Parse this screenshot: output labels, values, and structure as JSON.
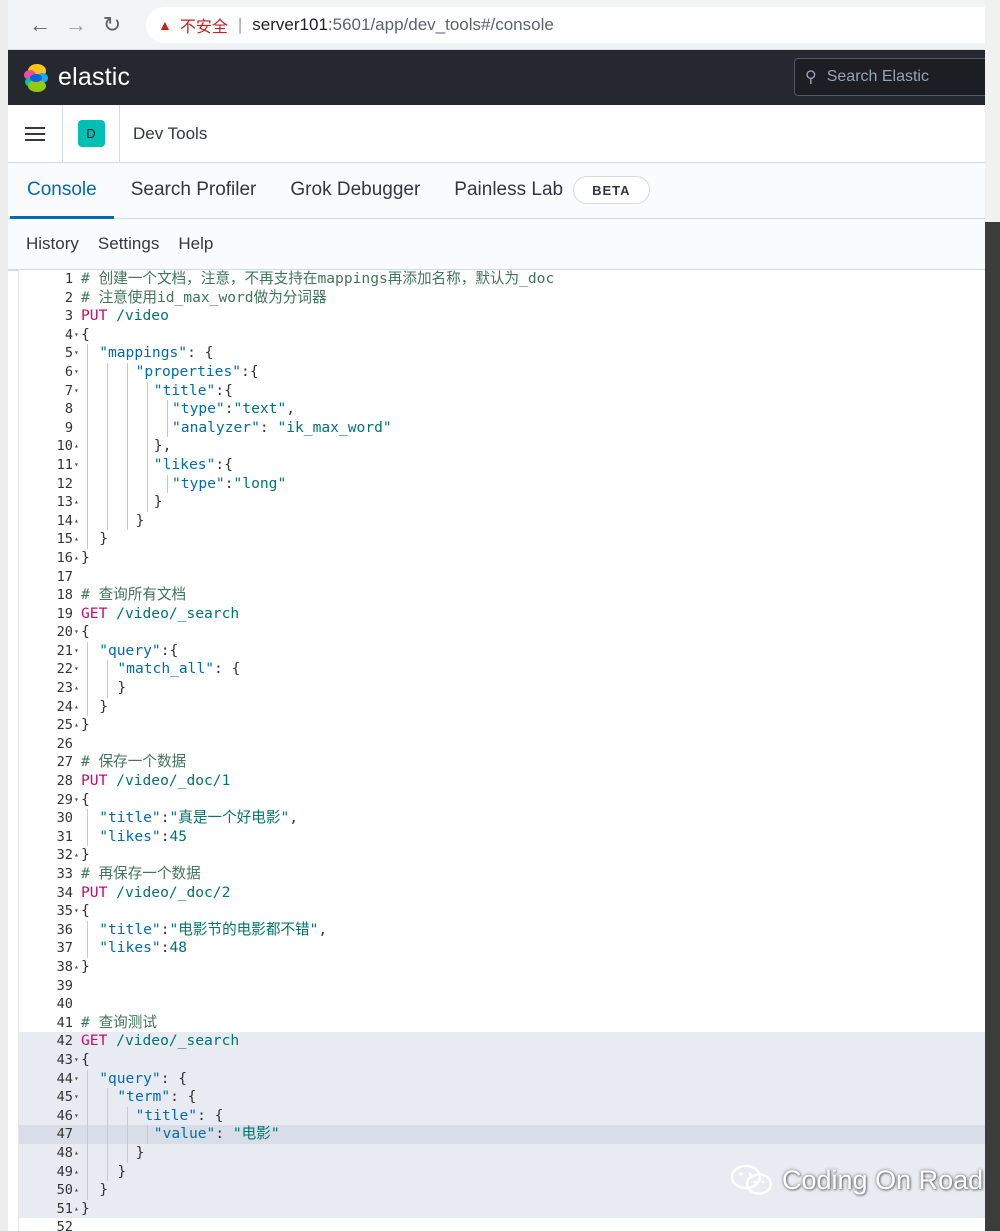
{
  "browser": {
    "insecure_label": "不安全",
    "separator": "|",
    "url_host": "server101",
    "url_rest": ":5601/app/dev_tools#/console"
  },
  "header": {
    "brand": "elastic",
    "search_placeholder": "Search Elastic"
  },
  "breadcrumb": {
    "space_initial": "D",
    "app_title": "Dev Tools"
  },
  "tabs": [
    {
      "label": "Console",
      "active": true
    },
    {
      "label": "Search Profiler",
      "active": false
    },
    {
      "label": "Grok Debugger",
      "active": false
    },
    {
      "label": "Painless Lab",
      "active": false
    }
  ],
  "beta_badge": "BETA",
  "console_menu": [
    "History",
    "Settings",
    "Help"
  ],
  "editor": {
    "lines": [
      {
        "n": "1",
        "fold": "",
        "indent": 0,
        "tokens": [
          [
            "c-comment",
            "# 创建一个文档，注意，不再支持在mappings再添加名称，默认为_doc"
          ]
        ]
      },
      {
        "n": "2",
        "fold": "",
        "indent": 0,
        "tokens": [
          [
            "c-comment",
            "# 注意使用id_max_word做为分词器"
          ]
        ]
      },
      {
        "n": "3",
        "fold": "",
        "indent": 0,
        "tokens": [
          [
            "c-method",
            "PUT"
          ],
          [
            "",
            " "
          ],
          [
            "c-url",
            "/video"
          ]
        ]
      },
      {
        "n": "4",
        "fold": "down",
        "indent": 0,
        "tokens": [
          [
            "c-brace",
            "{"
          ]
        ]
      },
      {
        "n": "5",
        "fold": "down",
        "indent": 1,
        "tokens": [
          [
            "c-key",
            "\"mappings\""
          ],
          [
            "c-brace",
            ": {"
          ]
        ]
      },
      {
        "n": "6",
        "fold": "down",
        "indent": 3,
        "tokens": [
          [
            "c-key",
            "\"properties\""
          ],
          [
            "c-brace",
            ":{"
          ]
        ]
      },
      {
        "n": "7",
        "fold": "down",
        "indent": 4,
        "tokens": [
          [
            "c-key",
            "\"title\""
          ],
          [
            "c-brace",
            ":{"
          ]
        ]
      },
      {
        "n": "8",
        "fold": "",
        "indent": 5,
        "tokens": [
          [
            "c-key",
            "\"type\""
          ],
          [
            "c-brace",
            ":"
          ],
          [
            "c-str",
            "\"text\""
          ],
          [
            "c-brace",
            ","
          ]
        ]
      },
      {
        "n": "9",
        "fold": "",
        "indent": 5,
        "tokens": [
          [
            "c-key",
            "\"analyzer\""
          ],
          [
            "c-brace",
            ": "
          ],
          [
            "c-str",
            "\"ik_max_word\""
          ]
        ]
      },
      {
        "n": "10",
        "fold": "up",
        "indent": 4,
        "tokens": [
          [
            "c-brace",
            "},"
          ]
        ]
      },
      {
        "n": "11",
        "fold": "down",
        "indent": 4,
        "tokens": [
          [
            "c-key",
            "\"likes\""
          ],
          [
            "c-brace",
            ":{"
          ]
        ]
      },
      {
        "n": "12",
        "fold": "",
        "indent": 5,
        "tokens": [
          [
            "c-key",
            "\"type\""
          ],
          [
            "c-brace",
            ":"
          ],
          [
            "c-str",
            "\"long\""
          ]
        ]
      },
      {
        "n": "13",
        "fold": "up",
        "indent": 4,
        "tokens": [
          [
            "c-brace",
            "}"
          ]
        ]
      },
      {
        "n": "14",
        "fold": "up",
        "indent": 3,
        "tokens": [
          [
            "c-brace",
            "}"
          ]
        ]
      },
      {
        "n": "15",
        "fold": "up",
        "indent": 1,
        "tokens": [
          [
            "c-brace",
            "}"
          ]
        ]
      },
      {
        "n": "16",
        "fold": "up",
        "indent": 0,
        "tokens": [
          [
            "c-brace",
            "}"
          ]
        ]
      },
      {
        "n": "17",
        "fold": "",
        "indent": 0,
        "tokens": []
      },
      {
        "n": "18",
        "fold": "",
        "indent": 0,
        "tokens": [
          [
            "c-comment",
            "# 查询所有文档"
          ]
        ]
      },
      {
        "n": "19",
        "fold": "",
        "indent": 0,
        "tokens": [
          [
            "c-method",
            "GET"
          ],
          [
            "",
            " "
          ],
          [
            "c-url",
            "/video/_search"
          ]
        ]
      },
      {
        "n": "20",
        "fold": "down",
        "indent": 0,
        "tokens": [
          [
            "c-brace",
            "{"
          ]
        ]
      },
      {
        "n": "21",
        "fold": "down",
        "indent": 1,
        "tokens": [
          [
            "c-key",
            "\"query\""
          ],
          [
            "c-brace",
            ":{"
          ]
        ]
      },
      {
        "n": "22",
        "fold": "down",
        "indent": 2,
        "tokens": [
          [
            "c-key",
            "\"match_all\""
          ],
          [
            "c-brace",
            ": {"
          ]
        ]
      },
      {
        "n": "23",
        "fold": "up",
        "indent": 2,
        "tokens": [
          [
            "c-brace",
            "}"
          ]
        ]
      },
      {
        "n": "24",
        "fold": "up",
        "indent": 1,
        "tokens": [
          [
            "c-brace",
            "}"
          ]
        ]
      },
      {
        "n": "25",
        "fold": "up",
        "indent": 0,
        "tokens": [
          [
            "c-brace",
            "}"
          ]
        ]
      },
      {
        "n": "26",
        "fold": "",
        "indent": 0,
        "tokens": []
      },
      {
        "n": "27",
        "fold": "",
        "indent": 0,
        "tokens": [
          [
            "c-comment",
            "# 保存一个数据"
          ]
        ]
      },
      {
        "n": "28",
        "fold": "",
        "indent": 0,
        "tokens": [
          [
            "c-method",
            "PUT"
          ],
          [
            "",
            " "
          ],
          [
            "c-url",
            "/video/_doc/1"
          ]
        ]
      },
      {
        "n": "29",
        "fold": "down",
        "indent": 0,
        "tokens": [
          [
            "c-brace",
            "{"
          ]
        ]
      },
      {
        "n": "30",
        "fold": "",
        "indent": 1,
        "tokens": [
          [
            "c-key",
            "\"title\""
          ],
          [
            "c-brace",
            ":"
          ],
          [
            "c-str",
            "\"真是一个好电影\""
          ],
          [
            "c-brace",
            ","
          ]
        ]
      },
      {
        "n": "31",
        "fold": "",
        "indent": 1,
        "tokens": [
          [
            "c-key",
            "\"likes\""
          ],
          [
            "c-brace",
            ":"
          ],
          [
            "c-num",
            "45"
          ]
        ]
      },
      {
        "n": "32",
        "fold": "up",
        "indent": 0,
        "tokens": [
          [
            "c-brace",
            "}"
          ]
        ]
      },
      {
        "n": "33",
        "fold": "",
        "indent": 0,
        "tokens": [
          [
            "c-comment",
            "# 再保存一个数据"
          ]
        ]
      },
      {
        "n": "34",
        "fold": "",
        "indent": 0,
        "tokens": [
          [
            "c-method",
            "PUT"
          ],
          [
            "",
            " "
          ],
          [
            "c-url",
            "/video/_doc/2"
          ]
        ]
      },
      {
        "n": "35",
        "fold": "down",
        "indent": 0,
        "tokens": [
          [
            "c-brace",
            "{"
          ]
        ]
      },
      {
        "n": "36",
        "fold": "",
        "indent": 1,
        "tokens": [
          [
            "c-key",
            "\"title\""
          ],
          [
            "c-brace",
            ":"
          ],
          [
            "c-str",
            "\"电影节的电影都不错\""
          ],
          [
            "c-brace",
            ","
          ]
        ]
      },
      {
        "n": "37",
        "fold": "",
        "indent": 1,
        "tokens": [
          [
            "c-key",
            "\"likes\""
          ],
          [
            "c-brace",
            ":"
          ],
          [
            "c-num",
            "48"
          ]
        ]
      },
      {
        "n": "38",
        "fold": "up",
        "indent": 0,
        "tokens": [
          [
            "c-brace",
            "}"
          ]
        ]
      },
      {
        "n": "39",
        "fold": "",
        "indent": 0,
        "tokens": []
      },
      {
        "n": "40",
        "fold": "",
        "indent": 0,
        "tokens": []
      },
      {
        "n": "41",
        "fold": "",
        "indent": 0,
        "tokens": [
          [
            "c-comment",
            "# 查询测试"
          ]
        ]
      },
      {
        "n": "42",
        "fold": "",
        "indent": 0,
        "req": true,
        "tokens": [
          [
            "c-method",
            "GET"
          ],
          [
            "",
            " "
          ],
          [
            "c-url",
            "/video/_search"
          ]
        ]
      },
      {
        "n": "43",
        "fold": "down",
        "indent": 0,
        "req": true,
        "tokens": [
          [
            "c-brace",
            "{"
          ]
        ]
      },
      {
        "n": "44",
        "fold": "down",
        "indent": 1,
        "req": true,
        "tokens": [
          [
            "c-key",
            "\"query\""
          ],
          [
            "c-brace",
            ": {"
          ]
        ]
      },
      {
        "n": "45",
        "fold": "down",
        "indent": 2,
        "req": true,
        "tokens": [
          [
            "c-key",
            "\"term\""
          ],
          [
            "c-brace",
            ": {"
          ]
        ]
      },
      {
        "n": "46",
        "fold": "down",
        "indent": 3,
        "req": true,
        "tokens": [
          [
            "c-key",
            "\"title\""
          ],
          [
            "c-brace",
            ": {"
          ]
        ]
      },
      {
        "n": "47",
        "fold": "",
        "indent": 4,
        "req": true,
        "active": true,
        "tokens": [
          [
            "c-key",
            "\"value\""
          ],
          [
            "c-brace",
            ": "
          ],
          [
            "c-str",
            "\"电影\""
          ]
        ]
      },
      {
        "n": "48",
        "fold": "up",
        "indent": 3,
        "req": true,
        "tokens": [
          [
            "c-brace",
            "}"
          ]
        ]
      },
      {
        "n": "49",
        "fold": "up",
        "indent": 2,
        "req": true,
        "tokens": [
          [
            "c-brace",
            "}"
          ]
        ]
      },
      {
        "n": "50",
        "fold": "up",
        "indent": 1,
        "req": true,
        "tokens": [
          [
            "c-brace",
            "}"
          ]
        ]
      },
      {
        "n": "51",
        "fold": "up",
        "indent": 0,
        "req": true,
        "tokens": [
          [
            "c-brace",
            "}"
          ]
        ]
      },
      {
        "n": "52",
        "fold": "",
        "indent": 0,
        "tokens": []
      }
    ]
  },
  "watermark": "Coding On Road",
  "colors": {
    "header_bg": "#25282f",
    "accent": "#006bb4",
    "space_avatar": "#00bfb3",
    "method": "#c80a68",
    "string": "#00756c",
    "key": "#006bb4",
    "comment": "#41755c",
    "insecure": "#c5221f"
  }
}
